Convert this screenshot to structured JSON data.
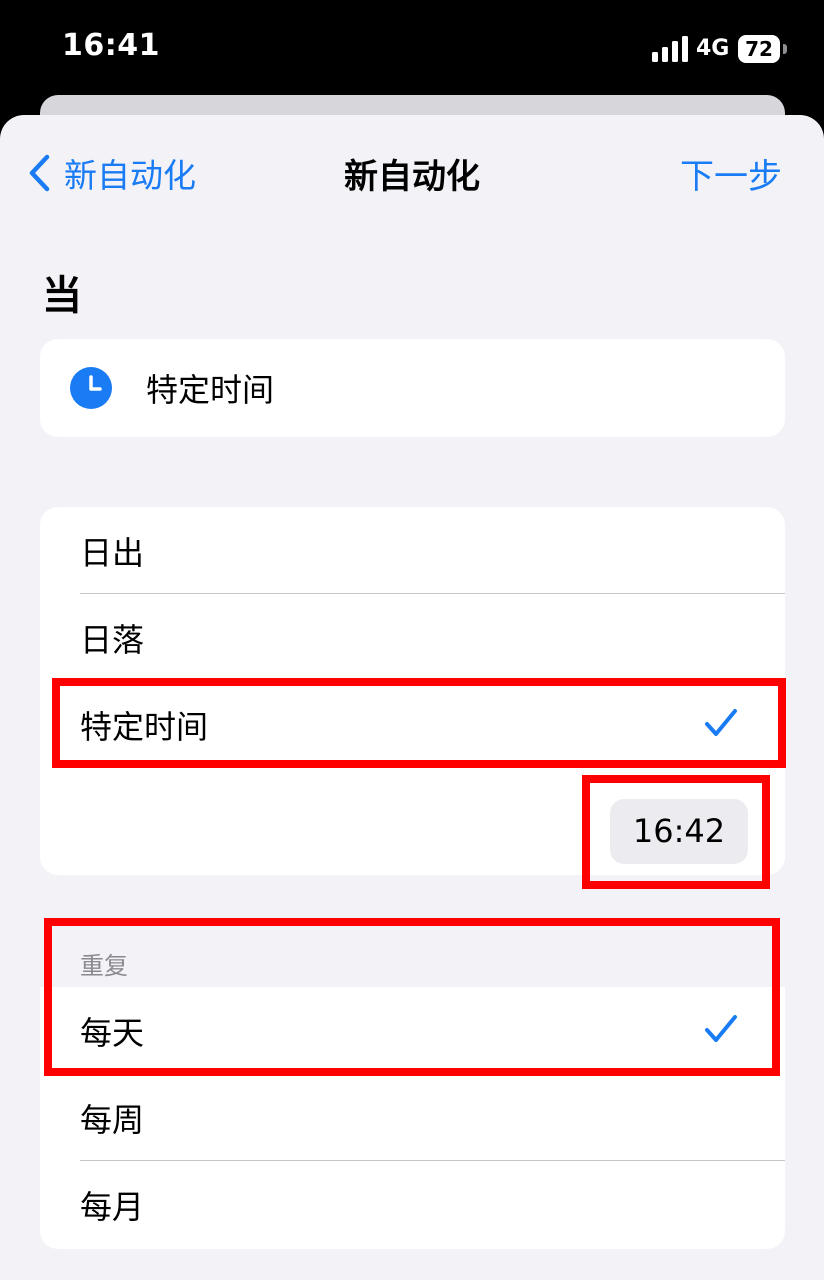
{
  "status_bar": {
    "time": "16:41",
    "network": "4G",
    "battery": "72",
    "signal_icon": "signal-bars-icon"
  },
  "nav": {
    "back_label": "新自动化",
    "title": "新自动化",
    "next_label": "下一步"
  },
  "section": {
    "title": "当"
  },
  "trigger": {
    "label": "特定时间",
    "icon": "clock-icon"
  },
  "time_options": [
    {
      "label": "日出",
      "selected": false
    },
    {
      "label": "日落",
      "selected": false
    },
    {
      "label": "特定时间",
      "selected": true
    }
  ],
  "selected_time": "16:42",
  "repeat": {
    "header": "重复",
    "options": [
      {
        "label": "每天",
        "selected": true
      },
      {
        "label": "每周",
        "selected": false
      },
      {
        "label": "每月",
        "selected": false
      }
    ]
  },
  "colors": {
    "accent": "#1a7cf5",
    "highlight": "#ff0000",
    "background": "#f2f2f7"
  }
}
